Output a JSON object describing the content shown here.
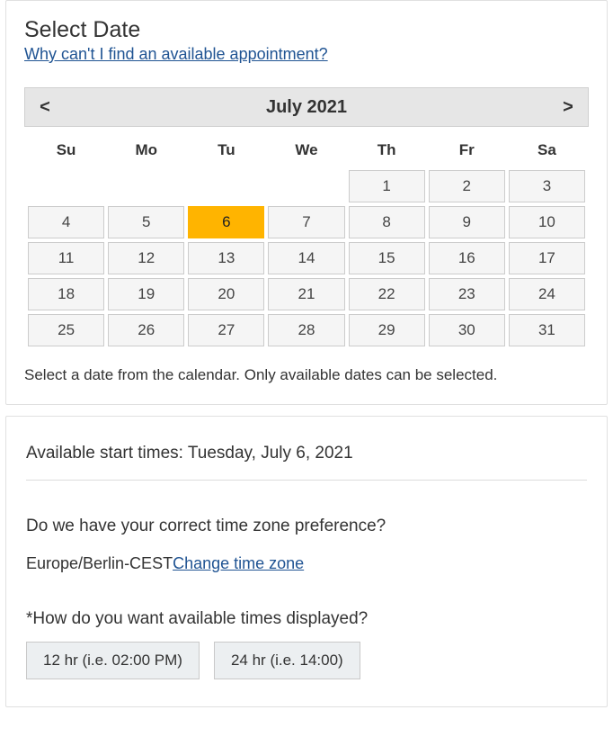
{
  "header": {
    "title": "Select Date",
    "help_link": "Why can't I find an available appointment?"
  },
  "calendar": {
    "prev": "<",
    "next": ">",
    "month_label": "July 2021",
    "dow": [
      "Su",
      "Mo",
      "Tu",
      "We",
      "Th",
      "Fr",
      "Sa"
    ],
    "weeks": [
      [
        null,
        null,
        null,
        null,
        1,
        2,
        3
      ],
      [
        4,
        5,
        6,
        7,
        8,
        9,
        10
      ],
      [
        11,
        12,
        13,
        14,
        15,
        16,
        17
      ],
      [
        18,
        19,
        20,
        21,
        22,
        23,
        24
      ],
      [
        25,
        26,
        27,
        28,
        29,
        30,
        31
      ]
    ],
    "selected_day": 6
  },
  "instruction": "Select a date from the calendar. Only available dates can be selected.",
  "times": {
    "heading": "Available start times: Tuesday, July 6, 2021",
    "tz_question": "Do we have your correct time zone preference?",
    "tz_value": "Europe/Berlin-CEST",
    "tz_change_link": "Change time zone",
    "format_question": "*How do you want available times displayed?",
    "format_options": {
      "hr12": "12 hr (i.e. 02:00 PM)",
      "hr24": "24 hr (i.e. 14:00)"
    }
  }
}
